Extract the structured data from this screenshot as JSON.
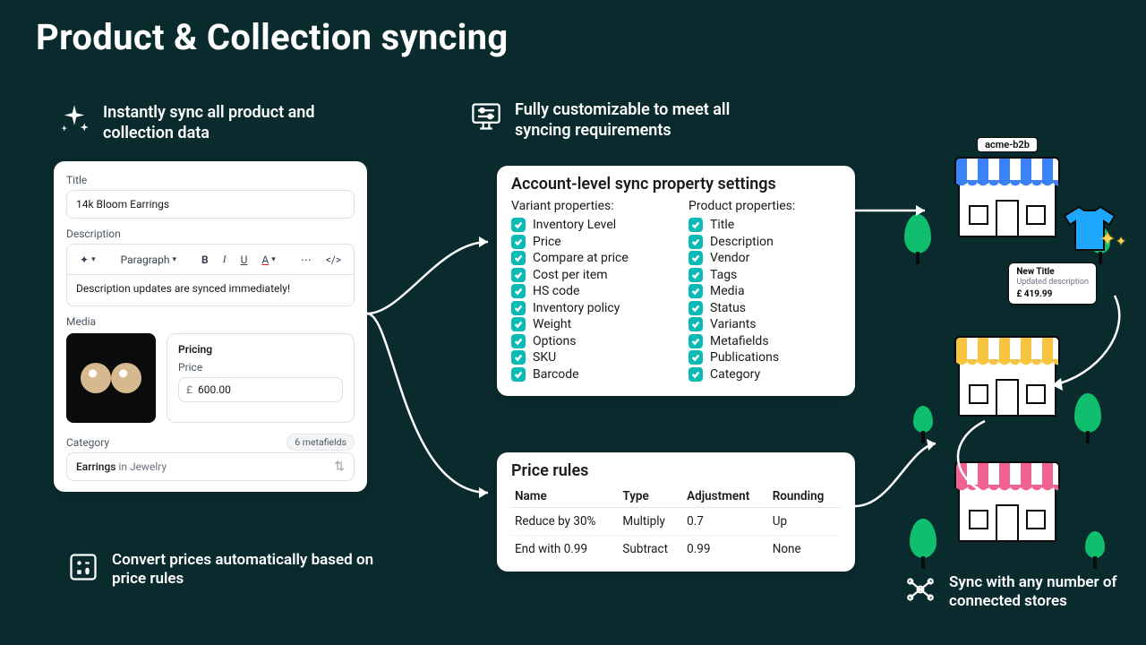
{
  "page_title": "Product & Collection syncing",
  "features": {
    "sync_all": "Instantly sync all product and collection data",
    "customizable": "Fully customizable to meet all syncing requirements",
    "convert_prices": "Convert prices automatically based on price rules",
    "multi_store": "Sync with any number of connected stores"
  },
  "product_editor": {
    "title_label": "Title",
    "title_value": "14k Bloom Earrings",
    "description_label": "Description",
    "description_value": "Description updates are synced immediately!",
    "paragraph_menu": "Paragraph",
    "media_label": "Media",
    "pricing_heading": "Pricing",
    "price_label": "Price",
    "price_currency": "£",
    "price_value": "600.00",
    "category_label": "Category",
    "metafields_badge": "6 metafields",
    "category_main": "Earrings",
    "category_sub": " in Jewelry"
  },
  "settings_panel": {
    "title": "Account-level sync property settings",
    "variant_heading": "Variant properties:",
    "product_heading": "Product properties:",
    "variant_props": [
      "Inventory Level",
      "Price",
      "Compare at price",
      "Cost per item",
      "HS code",
      "Inventory policy",
      "Weight",
      "Options",
      "SKU",
      "Barcode"
    ],
    "product_props": [
      "Title",
      "Description",
      "Vendor",
      "Tags",
      "Media",
      "Status",
      "Variants",
      "Metafields",
      "Publications",
      "Category"
    ]
  },
  "price_rules": {
    "title": "Price rules",
    "headers": [
      "Name",
      "Type",
      "Adjustment",
      "Rounding"
    ],
    "rows": [
      {
        "name": "Reduce by 30%",
        "type": "Multiply",
        "adjustment": "0.7",
        "rounding": "Up"
      },
      {
        "name": "End with 0.99",
        "type": "Subtract",
        "adjustment": "0.99",
        "rounding": "None"
      }
    ]
  },
  "right_side": {
    "store_label": "acme-b2b",
    "price_card": {
      "title": "New Title",
      "subtitle": "Updated description",
      "price": "£ 419.99"
    }
  }
}
